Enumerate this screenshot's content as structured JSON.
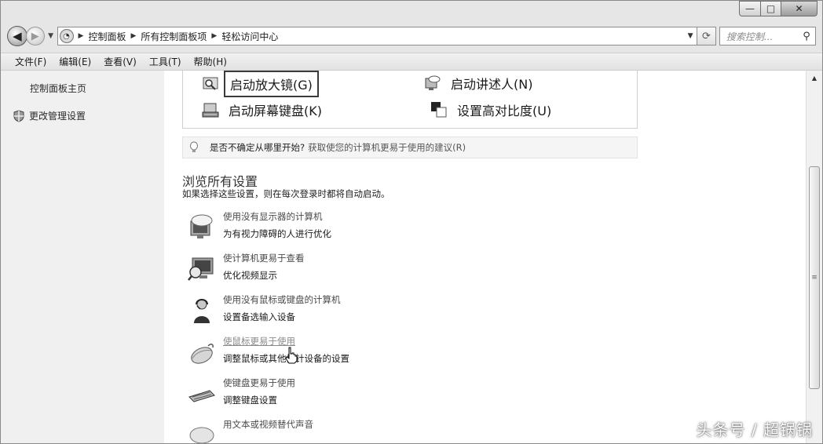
{
  "window": {
    "caption_min": "—",
    "caption_max": "□",
    "caption_close": "✕"
  },
  "address": {
    "breadcrumbs": [
      "控制面板",
      "所有控制面板项",
      "轻松访问中心"
    ],
    "search_placeholder": "搜索控制...",
    "back_icon": "back-arrow-icon",
    "forward_icon": "forward-arrow-icon"
  },
  "menubar": {
    "items": [
      "文件(F)",
      "编辑(E)",
      "查看(V)",
      "工具(T)",
      "帮助(H)"
    ]
  },
  "sidebar": {
    "items": [
      {
        "label": "控制面板主页",
        "icon": ""
      },
      {
        "label": "更改管理设置",
        "icon": "shield-icon"
      }
    ]
  },
  "quick_access": {
    "items": [
      {
        "label": "启动放大镜(G)",
        "icon": "magnifier-icon",
        "focused": true
      },
      {
        "label": "启动讲述人(N)",
        "icon": "narrator-icon"
      },
      {
        "label": "启动屏幕键盘(K)",
        "icon": "on-screen-keyboard-icon"
      },
      {
        "label": "设置高对比度(U)",
        "icon": "high-contrast-icon"
      }
    ]
  },
  "tip": {
    "prefix": "是否不确定从哪里开始?",
    "link": "获取使您的计算机更易于使用的建议(R)"
  },
  "browse": {
    "title": "浏览所有设置",
    "subtitle": "如果选择这些设置，则在每次登录时都将自动启动。",
    "settings": [
      {
        "title": "使用没有显示器的计算机",
        "desc": "为有视力障碍的人进行优化",
        "icon": "speech-monitor-icon"
      },
      {
        "title": "使计算机更易于查看",
        "desc": "优化视频显示",
        "icon": "monitor-magnifier-icon"
      },
      {
        "title": "使用没有鼠标或键盘的计算机",
        "desc": "设置备选输入设备",
        "icon": "headset-user-icon"
      },
      {
        "title": "使鼠标更易于使用",
        "desc": "调整鼠标或其他指针设备的设置",
        "icon": "mouse-icon"
      },
      {
        "title": "使键盘更易于使用",
        "desc": "调整键盘设置",
        "icon": "keyboard-icon"
      },
      {
        "title": "用文本或视频替代声音",
        "desc": "",
        "icon": "speech-bubble-icon"
      }
    ]
  },
  "watermark": "头条号 / 超锅锅"
}
